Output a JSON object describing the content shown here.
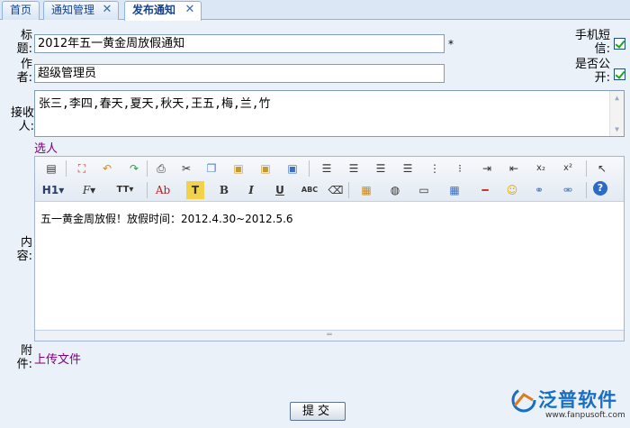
{
  "tabs": [
    {
      "label": "首页",
      "closable": false,
      "active": false
    },
    {
      "label": "通知管理",
      "closable": true,
      "active": false
    },
    {
      "label": "发布通知",
      "closable": true,
      "active": true
    }
  ],
  "form": {
    "title_label_1": "标",
    "title_label_2": "题:",
    "title_value": "2012年五一黄金周放假通知",
    "required_mark": "*",
    "author_label_1": "作",
    "author_label_2": "者:",
    "author_value": "超级管理员",
    "sms_label_1": "手机短",
    "sms_label_2": "信:",
    "sms_checked": true,
    "public_label_1": "是否公",
    "public_label_2": "开:",
    "public_checked": true,
    "receiver_label_1": "接收",
    "receiver_label_2": "人:",
    "receiver_value": "张三,李四,春天,夏天,秋天,王五,梅,兰,竹",
    "select_people_link": "选人",
    "content_label_1": "内",
    "content_label_2": "容:",
    "content_value": "五一黄金周放假！放假时间：2012.4.30~2012.5.6",
    "attachment_label_1": "附",
    "attachment_label_2": "件:",
    "upload_link": "上传文件",
    "submit_label": "提交"
  },
  "toolbar": {
    "row1": [
      "source-icon",
      "fullscreen-icon",
      "undo-icon",
      "redo-icon",
      "print-icon",
      "cut-icon",
      "copy-icon",
      "paste-icon",
      "paste-text-icon",
      "paste-word-icon",
      "align-left-icon",
      "align-center-icon",
      "align-right-icon",
      "justify-icon",
      "ordered-list-icon",
      "unordered-list-icon",
      "indent-icon",
      "outdent-icon",
      "subscript-icon",
      "superscript-icon",
      "select-icon"
    ],
    "heading_label": "H1",
    "font_label": "F",
    "size_label": "TT",
    "forecolor_label": "Ab",
    "bgcolor_label": "T",
    "bold_label": "B",
    "italic_label": "I",
    "underline_label": "U",
    "strike_label": "ABC"
  },
  "logo": {
    "brand": "泛普软件",
    "url": "www.fanpusoft.com"
  },
  "colors": {
    "background": "#eaf1f9",
    "tab_border": "#8db2e3",
    "link": "#800080",
    "brand": "#1a6ec2",
    "check": "#21a121"
  }
}
